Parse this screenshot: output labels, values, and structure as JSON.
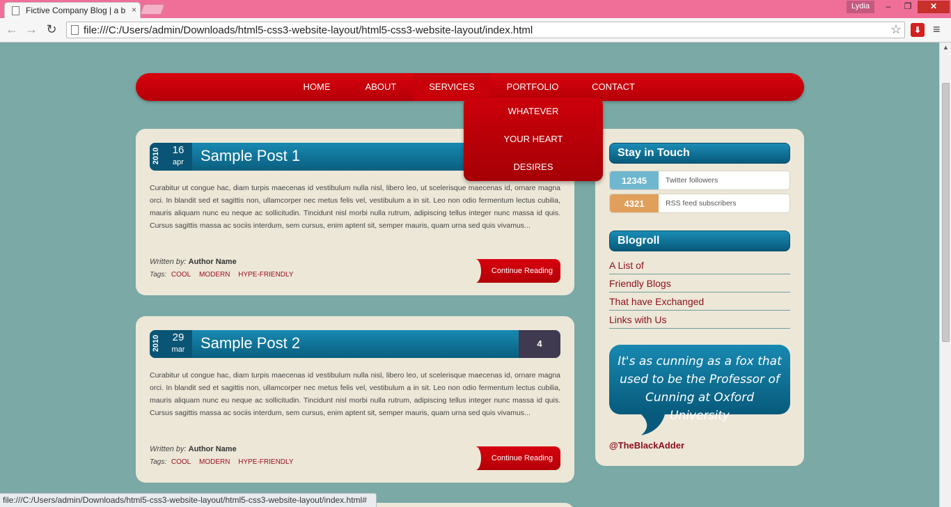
{
  "browser": {
    "tab_title": "Fictive Company Blog | a b",
    "tab_close": "×",
    "user": "Lydia",
    "win_min": "–",
    "win_max": "❐",
    "win_close": "✕",
    "url": "file:///C:/Users/admin/Downloads/html5-css3-website-layout/html5-css3-website-layout/index.html",
    "back": "←",
    "forward": "→",
    "reload": "↻",
    "star": "☆",
    "menu": "≡",
    "status_url": "file:///C:/Users/admin/Downloads/html5-css3-website-layout/html5-css3-website-layout/index.html#"
  },
  "nav": {
    "items": [
      "HOME",
      "ABOUT",
      "SERVICES",
      "PORTFOLIO",
      "CONTACT"
    ],
    "active": "SERVICES",
    "dropdown": [
      "WHATEVER",
      "YOUR HEART",
      "DESIRES"
    ]
  },
  "posts": [
    {
      "year": "2010",
      "day": "16",
      "month": "apr",
      "title": "Sample Post 1",
      "body": "Curabitur ut congue hac, diam turpis maecenas id vestibulum nulla nisl, libero leo, ut scelerisque maecenas id, ornare magna orci. In blandit sed et sagittis non, ullamcorper nec metus felis vel, vestibulum a in sit. Leo non odio fermentum lectus cubilia, mauris aliquam nunc eu neque ac sollicitudin. Tincidunt nisl morbi nulla rutrum, adipiscing tellus integer nunc massa id quis. Cursus sagittis massa ac sociis interdum, sem cursus, enim aptent sit, semper mauris, quam urna sed quis vivamus...",
      "written_by_label": "Written by:",
      "author": "Author Name",
      "tags_label": "Tags:",
      "tags": [
        "COOL",
        "MODERN",
        "HYPE-FRIENDLY"
      ],
      "button": "Continue Reading"
    },
    {
      "year": "2010",
      "day": "29",
      "month": "mar",
      "title": "Sample Post 2",
      "comments": "4",
      "body": "Curabitur ut congue hac, diam turpis maecenas id vestibulum nulla nisl, libero leo, ut scelerisque maecenas id, ornare magna orci. In blandit sed et sagittis non, ullamcorper nec metus felis vel, vestibulum a in sit. Leo non odio fermentum lectus cubilia, mauris aliquam nunc eu neque ac sollicitudin. Tincidunt nisl morbi nulla rutrum, adipiscing tellus integer nunc massa id quis. Cursus sagittis massa ac sociis interdum, sem cursus, enim aptent sit, semper mauris, quam urna sed quis vivamus...",
      "written_by_label": "Written by:",
      "author": "Author Name",
      "tags_label": "Tags:",
      "tags": [
        "COOL",
        "MODERN",
        "HYPE-FRIENDLY"
      ],
      "button": "Continue Reading"
    }
  ],
  "sidebar": {
    "stay_title": "Stay in Touch",
    "twitter_count": "12345",
    "twitter_label": "Twitter followers",
    "rss_count": "4321",
    "rss_label": "RSS feed subscribers",
    "blogroll_title": "Blogroll",
    "blogroll": [
      "A List of",
      "Friendly Blogs",
      "That have Exchanged",
      "Links with Us"
    ],
    "quote": "It's as cunning as a fox that used to be the Professor of Cunning at Oxford University",
    "handle": "@TheBlackAdder"
  },
  "colors": {
    "page_bg": "#7aa9a6",
    "nav_red": "#d8000c",
    "header_blue": "#1889b1",
    "twitter": "#6fb6cf",
    "rss": "#e0a05c"
  }
}
